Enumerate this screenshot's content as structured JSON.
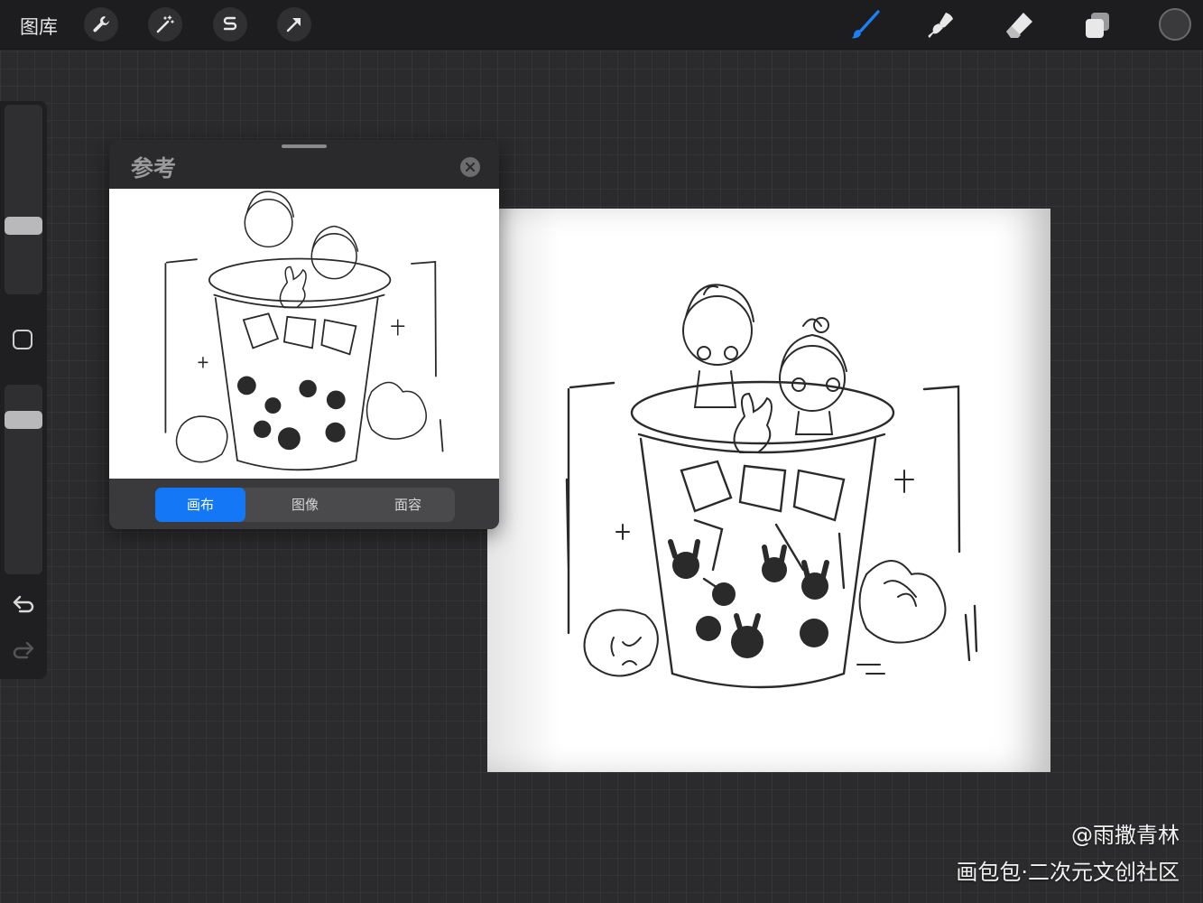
{
  "toolbar": {
    "gallery_label": "图库",
    "left_tools": [
      "wrench-icon",
      "magic-wand-icon",
      "selection-s-icon",
      "transform-arrow-icon"
    ],
    "right_tools": [
      "brush-icon",
      "smudge-icon",
      "eraser-icon",
      "layers-icon"
    ],
    "active_tool_color": "#1b7ff5",
    "current_color": "#3a3a3c"
  },
  "reference": {
    "title": "参考",
    "tabs": [
      {
        "label": "画布",
        "active": true
      },
      {
        "label": "图像",
        "active": false
      },
      {
        "label": "面容",
        "active": false
      }
    ],
    "accent": "#1478f6"
  },
  "watermark": {
    "line1": "@雨撒青林",
    "line2": "画包包·二次元文创社区"
  }
}
